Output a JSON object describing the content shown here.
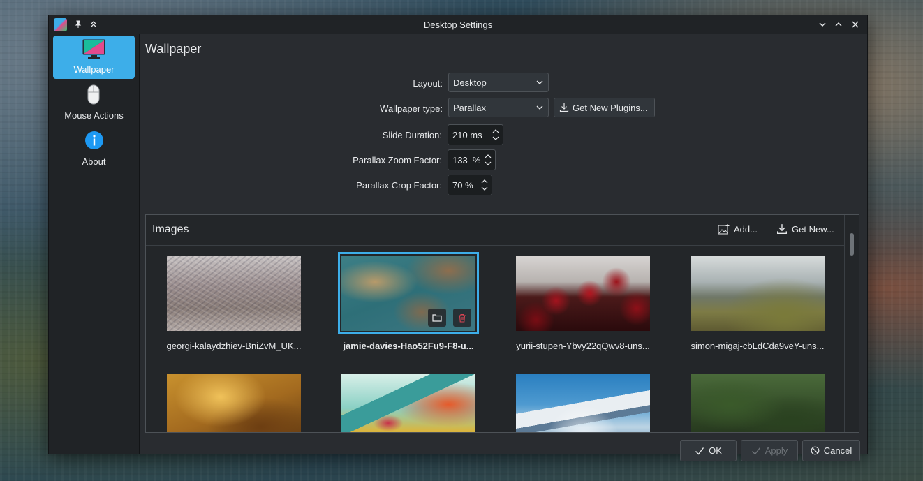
{
  "window": {
    "title": "Desktop Settings"
  },
  "sidebar": {
    "items": [
      {
        "label": "Wallpaper",
        "icon": "monitor-icon",
        "active": true
      },
      {
        "label": "Mouse Actions",
        "icon": "mouse-icon",
        "active": false
      },
      {
        "label": "About",
        "icon": "info-icon",
        "active": false
      }
    ]
  },
  "page": {
    "title": "Wallpaper"
  },
  "form": {
    "layout_label": "Layout:",
    "layout_value": "Desktop",
    "wallpaper_type_label": "Wallpaper type:",
    "wallpaper_type_value": "Parallax",
    "get_plugins_label": "Get New Plugins...",
    "slide_duration_label": "Slide Duration:",
    "slide_duration_value": "210 ms",
    "zoom_factor_label": "Parallax Zoom Factor:",
    "zoom_factor_value": "133  %",
    "crop_factor_label": "Parallax Crop Factor:",
    "crop_factor_value": "70 %"
  },
  "images": {
    "title": "Images",
    "add_label": "Add...",
    "get_new_label": "Get New...",
    "items": [
      {
        "caption": "georgi-kalaydzhiev-BniZvM_UK...",
        "selected": false
      },
      {
        "caption": "jamie-davies-Hao52Fu9-F8-u...",
        "selected": true
      },
      {
        "caption": "yurii-stupen-Ybvy22qQwv8-uns...",
        "selected": false
      },
      {
        "caption": "simon-migaj-cbLdCda9veY-uns...",
        "selected": false
      },
      {
        "caption": "",
        "selected": false
      },
      {
        "caption": "",
        "selected": false
      },
      {
        "caption": "",
        "selected": false
      },
      {
        "caption": "",
        "selected": false
      }
    ]
  },
  "footer": {
    "ok_label": "OK",
    "apply_label": "Apply",
    "cancel_label": "Cancel"
  },
  "colors": {
    "accent": "#3daee9",
    "window_bg": "#202326",
    "content_bg": "#292c30",
    "delete_red": "#da4453"
  }
}
